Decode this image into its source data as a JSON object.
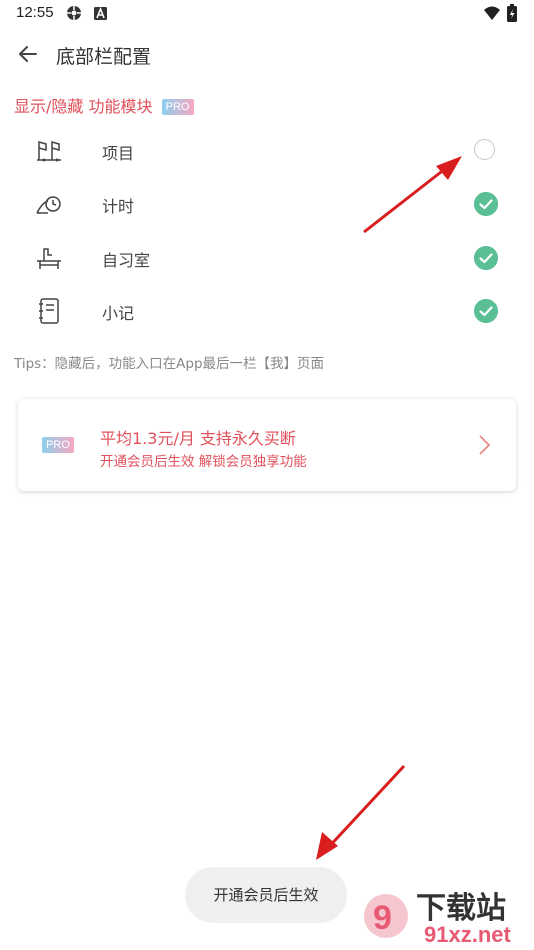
{
  "status_bar": {
    "time": "12:55",
    "icons": [
      "settings-sync-icon",
      "a-badge-icon",
      "wifi-icon",
      "battery-charging-icon"
    ]
  },
  "header": {
    "title": "底部栏配置",
    "back_icon": "arrow-left-icon"
  },
  "section": {
    "title": "显示/隐藏 功能模块",
    "badge": "PRO"
  },
  "modules": [
    {
      "label": "项目",
      "icon": "flag-project-icon",
      "enabled": false
    },
    {
      "label": "计时",
      "icon": "hand-timer-icon",
      "enabled": true
    },
    {
      "label": "自习室",
      "icon": "study-desk-icon",
      "enabled": true
    },
    {
      "label": "小记",
      "icon": "notebook-icon",
      "enabled": true
    }
  ],
  "tips": "Tips：隐藏后，功能入口在App最后一栏【我】页面",
  "promo": {
    "badge": "PRO",
    "main": "平均1.3元/月 支持永久买断",
    "sub": "开通会员后生效 解锁会员独享功能"
  },
  "toast": "开通会员后生效",
  "watermark": {
    "text": "下载站",
    "url_text": "91xz.net"
  },
  "colors": {
    "accent": "#e0505a",
    "check": "#5bbf96",
    "annotation_arrow": "#d81e1e"
  }
}
